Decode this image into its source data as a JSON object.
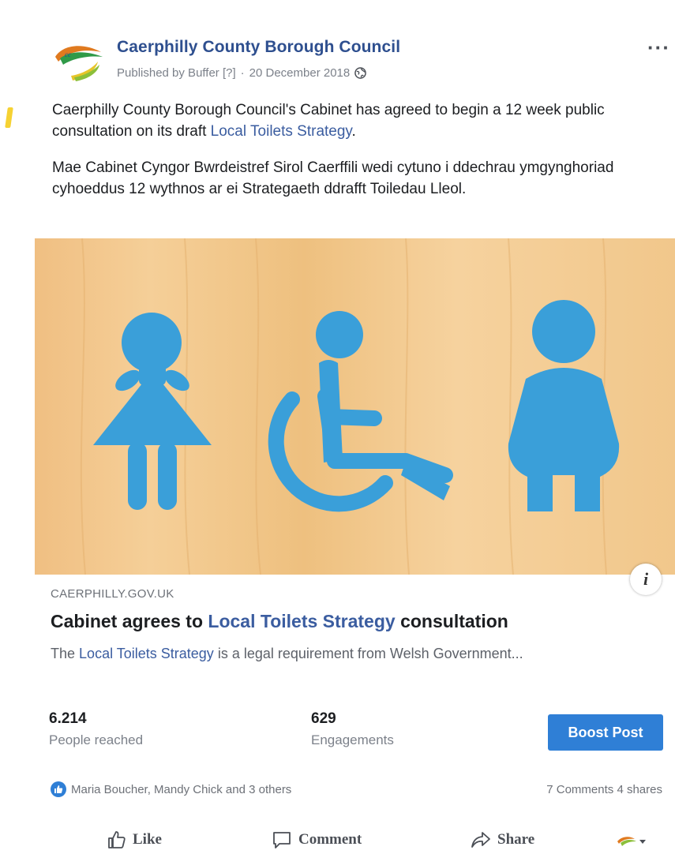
{
  "header": {
    "page_name": "Caerphilly County Borough Council",
    "published_by": "Published by Buffer [?]",
    "separator": "·",
    "date": "20 December 2018",
    "more_label": "···"
  },
  "body": {
    "en_prefix": "Caerphilly County Borough Council's Cabinet has agreed to begin a 12 week public consultation on its draft",
    "en_link": "Local Toilets Strategy",
    "en_suffix": ".",
    "cy_text": "Mae Cabinet Cyngor Bwrdeistref Sirol Caerffili wedi cytuno i ddechrau ymgynghoriad cyhoeddus 12 wythnos ar ei Strategaeth ddrafft Toiledau Lleol",
    "cy_suffix": "."
  },
  "link_preview": {
    "domain": "CAERPHILLY.GOV.UK",
    "title_prefix": "Cabinet agrees to",
    "title_link": "Local Toilets Strategy",
    "title_suffix": "consultation",
    "desc_prefix": "The",
    "desc_link": "Local Toilets Strategy",
    "desc_suffix": "is a legal requirement from Welsh Government...",
    "info_label": "i"
  },
  "insights": {
    "reach_value": "6.214",
    "reach_label": "People reached",
    "engagement_value": "629",
    "engagement_label": "Engagements",
    "boost_label": "Boost Post"
  },
  "social": {
    "reactions_text": "Maria Boucher, Mandy Chick and 3 others",
    "comments": "7 Comments",
    "shares": "4 shares"
  },
  "actions": {
    "like": "Like",
    "comment": "Comment",
    "share": "Share"
  },
  "colors": {
    "page_name": "#2e4f8f",
    "link": "#3b5da0",
    "boost": "#2f7fd6",
    "sign_icons": "#3a9fd9",
    "wood": "#f0c283"
  },
  "icons": [
    "page-logo",
    "globe-icon",
    "restroom-signs-image",
    "info-icon",
    "like-reaction-icon",
    "like-icon",
    "comment-icon",
    "share-icon",
    "page-avatar-dropdown"
  ]
}
